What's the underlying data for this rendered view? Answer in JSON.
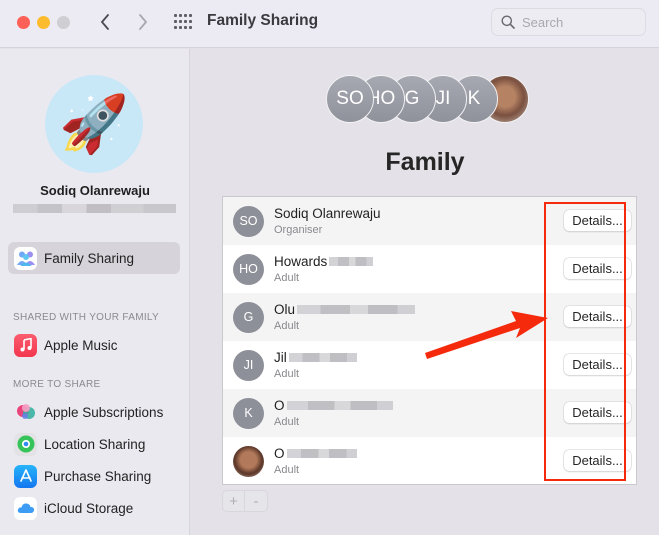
{
  "window": {
    "title": "Family Sharing",
    "search_placeholder": "Search"
  },
  "sidebar": {
    "profile": {
      "name": "Sodiq Olanrewaju",
      "avatar_emoji": "🚀",
      "email_redacted": true
    },
    "top_items": [
      {
        "label": "Family Sharing",
        "icon": "family-sharing-icon",
        "active": true
      }
    ],
    "sections": [
      {
        "header": "SHARED WITH YOUR FAMILY",
        "items": [
          {
            "label": "Apple Music",
            "icon": "apple-music-icon"
          }
        ]
      },
      {
        "header": "MORE TO SHARE",
        "items": [
          {
            "label": "Apple Subscriptions",
            "icon": "apple-subscriptions-icon"
          },
          {
            "label": "Location Sharing",
            "icon": "find-my-icon"
          },
          {
            "label": "Purchase Sharing",
            "icon": "app-store-icon"
          },
          {
            "label": "iCloud Storage",
            "icon": "icloud-icon"
          }
        ]
      }
    ]
  },
  "main": {
    "header_avatars": [
      "SO",
      "HO",
      "G",
      "JI",
      "K",
      "photo"
    ],
    "title": "Family",
    "members": [
      {
        "initials": "SO",
        "name": "Sodiq Olanrewaju",
        "redacted": false,
        "role": "Organiser",
        "button": "Details..."
      },
      {
        "initials": "HO",
        "name": "Howards",
        "redacted": true,
        "role": "Adult",
        "button": "Details..."
      },
      {
        "initials": "G",
        "name": "Olu",
        "redacted": true,
        "role": "Adult",
        "button": "Details..."
      },
      {
        "initials": "JI",
        "name": "Jil",
        "redacted": true,
        "role": "Adult",
        "button": "Details..."
      },
      {
        "initials": "K",
        "name": "O",
        "redacted": true,
        "role": "Adult",
        "button": "Details..."
      },
      {
        "initials": "",
        "name": "O",
        "redacted": true,
        "role": "Adult",
        "button": "Details...",
        "photo": true
      }
    ],
    "add_label": "+",
    "remove_label": "-"
  },
  "annotation": {
    "color": "#f52a0c",
    "highlight": "Details... buttons",
    "arrow_target": "Details... button (row 3)"
  }
}
